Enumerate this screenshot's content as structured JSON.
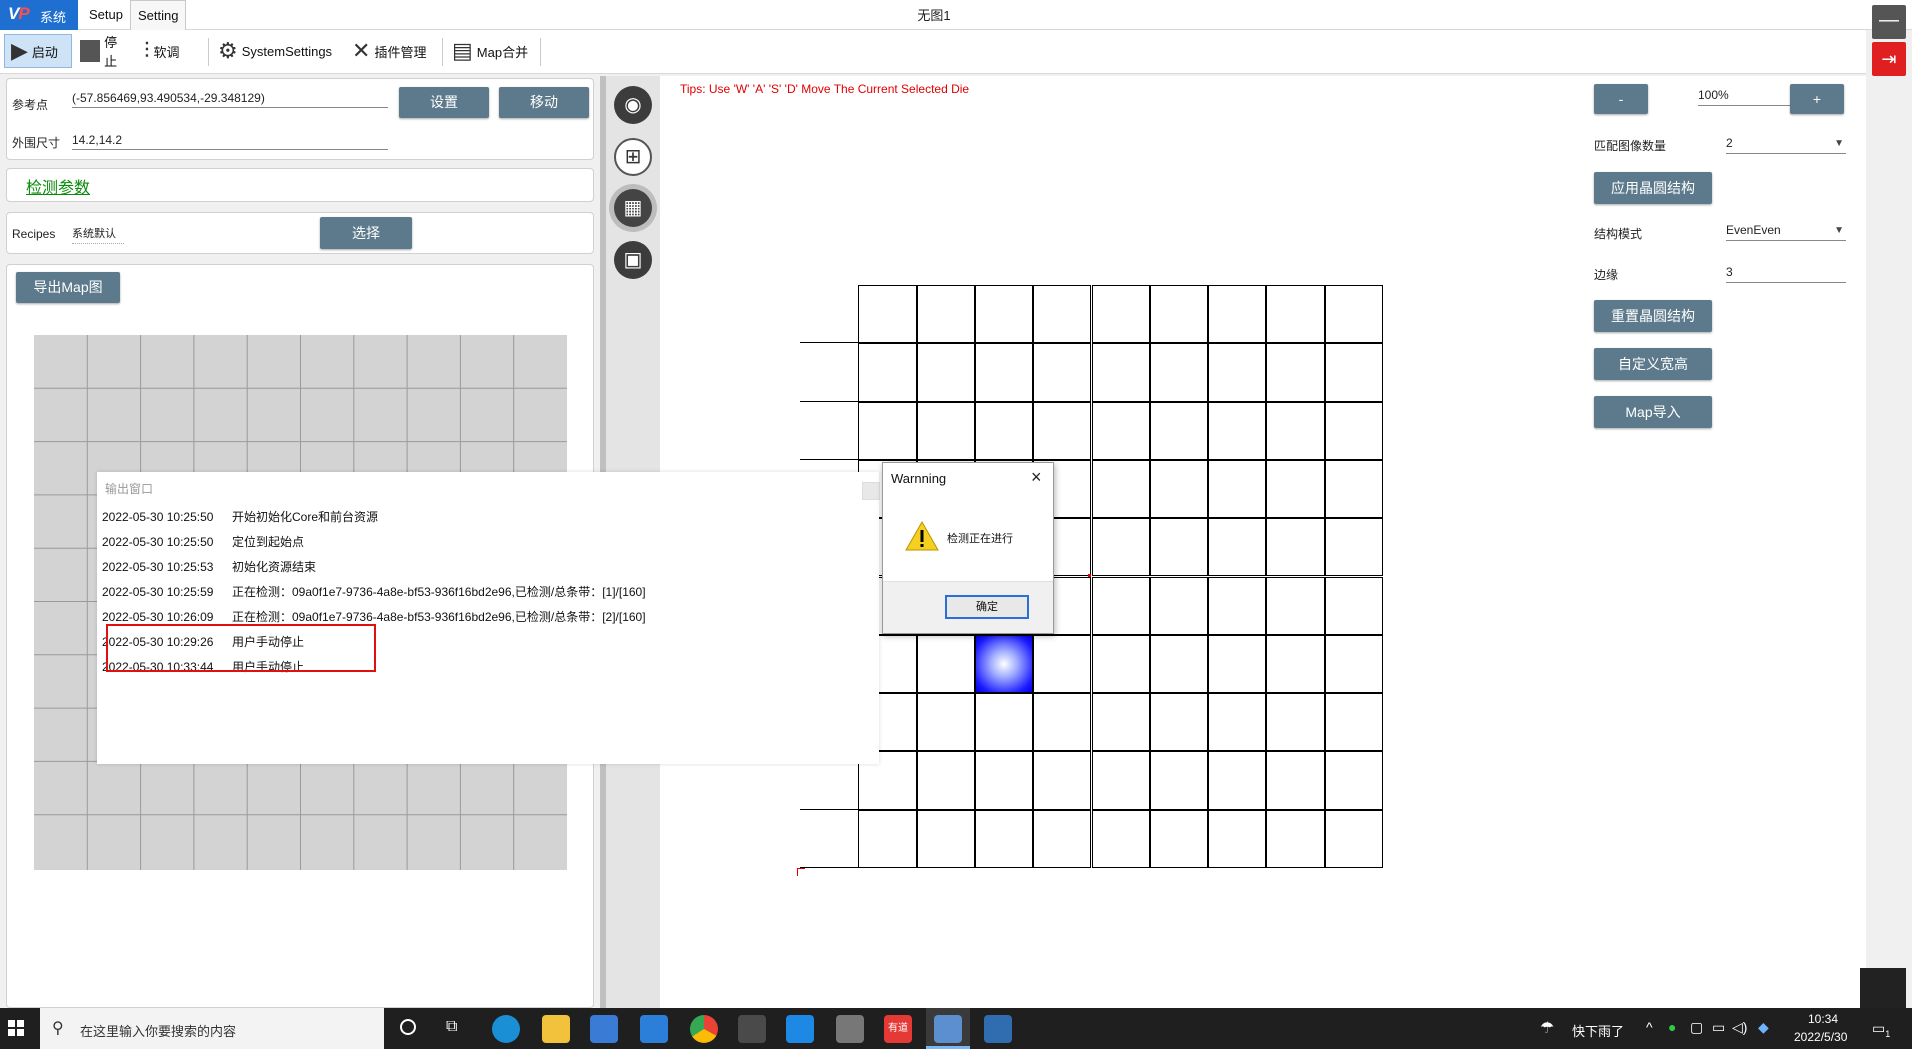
{
  "app": {
    "title": "无图1",
    "logo_text": "系统",
    "menu_tabs": [
      "Setup",
      "Setting"
    ]
  },
  "toolbar": {
    "start": "启动",
    "stop": "停止",
    "tune": "软调",
    "system_settings": "SystemSettings",
    "plugin_manager": "插件管理",
    "map_merge": "Map合并"
  },
  "left": {
    "ref_point_label": "参考点",
    "ref_point_value": "(-57.856469,93.490534,-29.348129)",
    "outer_size_label": "外围尺寸",
    "outer_size_value": "14.2,14.2",
    "set_button": "设置",
    "move_button": "移动",
    "detect_params_link": "检测参数",
    "recipes_label": "Recipes",
    "recipes_value": "系统默认",
    "select_button": "选择",
    "export_map_button": "导出Map图"
  },
  "canvas": {
    "tips": "Tips: Use 'W' 'A' 'S' 'D' Move The Current Selected Die"
  },
  "right": {
    "zoom_minus": "-",
    "zoom_value": "100%",
    "zoom_plus": "+",
    "match_count_label": "匹配图像数量",
    "match_count_value": "2",
    "apply_wafer_button": "应用晶圆结构",
    "struct_mode_label": "结构模式",
    "struct_mode_value": "EvenEven",
    "edge_label": "边缘",
    "edge_value": "3",
    "reset_wafer_button": "重置晶圆结构",
    "custom_size_button": "自定义宽高",
    "map_import_button": "Map导入"
  },
  "output_window": {
    "title": "输出窗口",
    "logs": [
      {
        "time": "2022-05-30 10:25:50",
        "msg": "开始初始化Core和前台资源"
      },
      {
        "time": "2022-05-30 10:25:50",
        "msg": "定位到起始点"
      },
      {
        "time": "2022-05-30 10:25:53",
        "msg": "初始化资源结束"
      },
      {
        "time": "2022-05-30 10:25:59",
        "msg": "正在检测：09a0f1e7-9736-4a8e-bf53-936f16bd2e96,已检测/总条带：[1]/[160]"
      },
      {
        "time": "2022-05-30 10:26:09",
        "msg": "正在检测：09a0f1e7-9736-4a8e-bf53-936f16bd2e96,已检测/总条带：[2]/[160]"
      },
      {
        "time": "2022-05-30 10:29:26",
        "msg": "用户手动停止"
      },
      {
        "time": "2022-05-30 10:33:44",
        "msg": "用户手动停止"
      }
    ]
  },
  "dialog": {
    "title": "Warnning",
    "message": "检测正在进行",
    "ok": "确定"
  },
  "taskbar": {
    "search_placeholder": "在这里输入你要搜索的内容",
    "weather": "快下雨了",
    "time": "10:34",
    "date": "2022/5/30",
    "notification_count": "1",
    "youdao_label": "有道"
  },
  "colors": {
    "accent": "#1e6fd0",
    "button": "#5c7a8b",
    "tips": "#e00000",
    "highlight_die": "#1a1aff",
    "stop_box": "#e01010"
  }
}
